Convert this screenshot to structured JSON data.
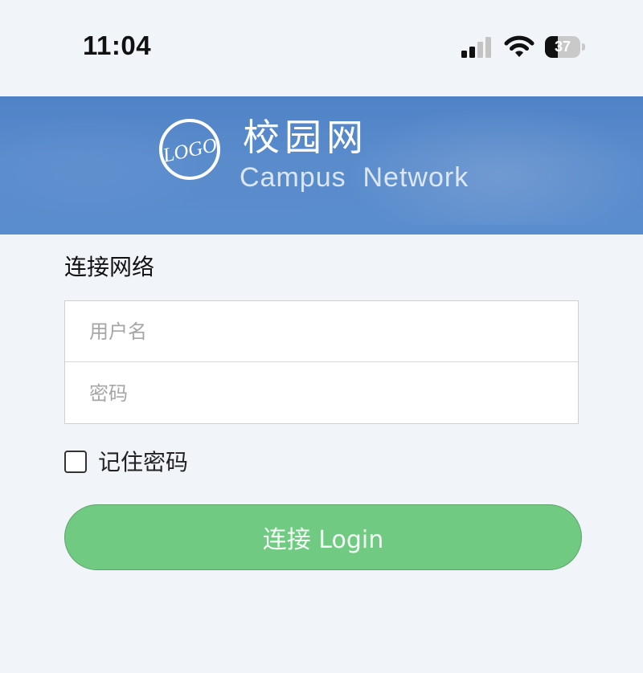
{
  "status_bar": {
    "time": "11:04",
    "battery_level": "37",
    "battery_percent": 37,
    "signal_bars_active": 2,
    "signal_bars_total": 4,
    "icons": [
      "cellular-signal-icon",
      "wifi-icon",
      "battery-icon"
    ]
  },
  "banner": {
    "logo_text": "LOGO",
    "title_cn": "校园网",
    "title_en": "Campus  Network",
    "color": "#5a8dce"
  },
  "form": {
    "heading": "连接网络",
    "username_placeholder": "用户名",
    "username_value": "",
    "password_placeholder": "密码",
    "password_value": "",
    "remember_label": "记住密码",
    "remember_checked": false,
    "submit_label": "连接 Login",
    "submit_color": "#70ca82"
  }
}
